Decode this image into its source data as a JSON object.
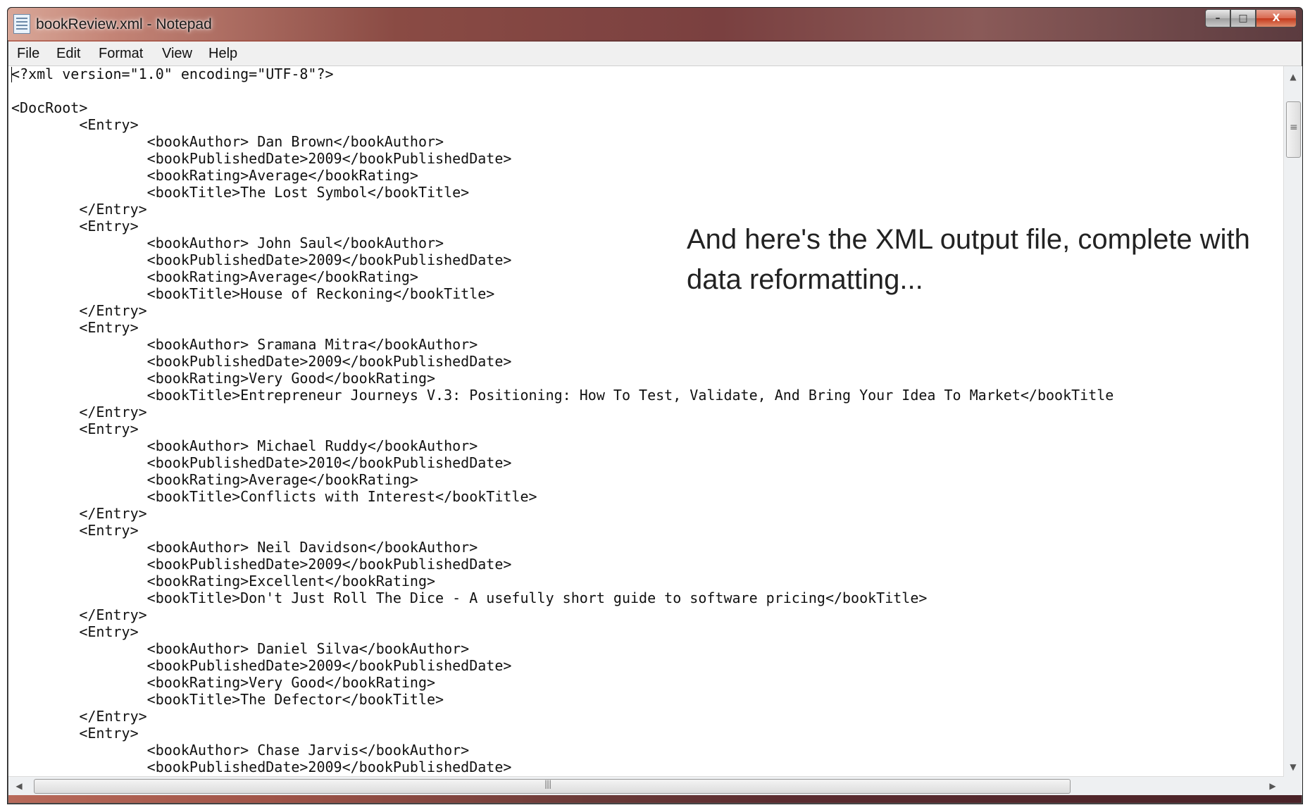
{
  "window": {
    "title": "bookReview.xml - Notepad"
  },
  "caption_buttons": {
    "minimize": "–",
    "maximize": "□",
    "close": "X"
  },
  "menu": [
    "File",
    "Edit",
    "Format",
    "View",
    "Help"
  ],
  "editor_lines": [
    "<?xml version=\"1.0\" encoding=\"UTF-8\"?>",
    "",
    "<DocRoot>",
    "        <Entry>",
    "                <bookAuthor> Dan Brown</bookAuthor>",
    "                <bookPublishedDate>2009</bookPublishedDate>",
    "                <bookRating>Average</bookRating>",
    "                <bookTitle>The Lost Symbol</bookTitle>",
    "        </Entry>",
    "        <Entry>",
    "                <bookAuthor> John Saul</bookAuthor>",
    "                <bookPublishedDate>2009</bookPublishedDate>",
    "                <bookRating>Average</bookRating>",
    "                <bookTitle>House of Reckoning</bookTitle>",
    "        </Entry>",
    "        <Entry>",
    "                <bookAuthor> Sramana Mitra</bookAuthor>",
    "                <bookPublishedDate>2009</bookPublishedDate>",
    "                <bookRating>Very Good</bookRating>",
    "                <bookTitle>Entrepreneur Journeys V.3: Positioning: How To Test, Validate, And Bring Your Idea To Market</bookTitle",
    "        </Entry>",
    "        <Entry>",
    "                <bookAuthor> Michael Ruddy</bookAuthor>",
    "                <bookPublishedDate>2010</bookPublishedDate>",
    "                <bookRating>Average</bookRating>",
    "                <bookTitle>Conflicts with Interest</bookTitle>",
    "        </Entry>",
    "        <Entry>",
    "                <bookAuthor> Neil Davidson</bookAuthor>",
    "                <bookPublishedDate>2009</bookPublishedDate>",
    "                <bookRating>Excellent</bookRating>",
    "                <bookTitle>Don't Just Roll The Dice - A usefully short guide to software pricing</bookTitle>",
    "        </Entry>",
    "        <Entry>",
    "                <bookAuthor> Daniel Silva</bookAuthor>",
    "                <bookPublishedDate>2009</bookPublishedDate>",
    "                <bookRating>Very Good</bookRating>",
    "                <bookTitle>The Defector</bookTitle>",
    "        </Entry>",
    "        <Entry>",
    "                <bookAuthor> Chase Jarvis</bookAuthor>",
    "                <bookPublishedDate>2009</bookPublishedDate>"
  ],
  "note": "And here's the XML output file, complete with data reformatting..."
}
